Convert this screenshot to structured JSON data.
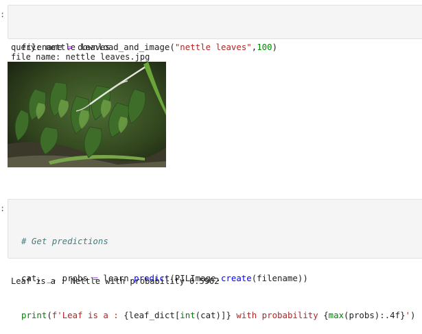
{
  "cell1": {
    "prompt": ":",
    "code": {
      "var": "filename",
      "op": "=",
      "fn": "download_and_image",
      "paren_open": "(",
      "arg_str": "\"nettle leaves\"",
      "comma": ",",
      "arg_num": "100",
      "paren_close": ")"
    }
  },
  "output1": {
    "query_line": "query: nettle leaves",
    "filename_line": "file name: nettle leaves.jpg",
    "image_icon": "nettle-leaves-photo"
  },
  "cell2": {
    "prompt": ":",
    "comment": "# Get predictions",
    "line2": {
      "vars": "cat, _, probs ",
      "op": "=",
      "pre": " learn.",
      "fn": "predict",
      "mid1": "(PILImage.",
      "fn2": "create",
      "post": "(filename))"
    },
    "line3": {
      "print": "print",
      "open": "(",
      "str1": "f'Leaf is a : ",
      "brace1": "{leaf_dict[",
      "int": "int",
      "cat": "(cat)",
      "brace1_close": "]}",
      "str2": " with probability ",
      "brace2": "{",
      "max": "max",
      "probs": "(probs):.4f}",
      "str3": "'",
      "close": ")"
    }
  },
  "output2": {
    "text": "Leaf is a : Nettle with probability 0.5902"
  }
}
